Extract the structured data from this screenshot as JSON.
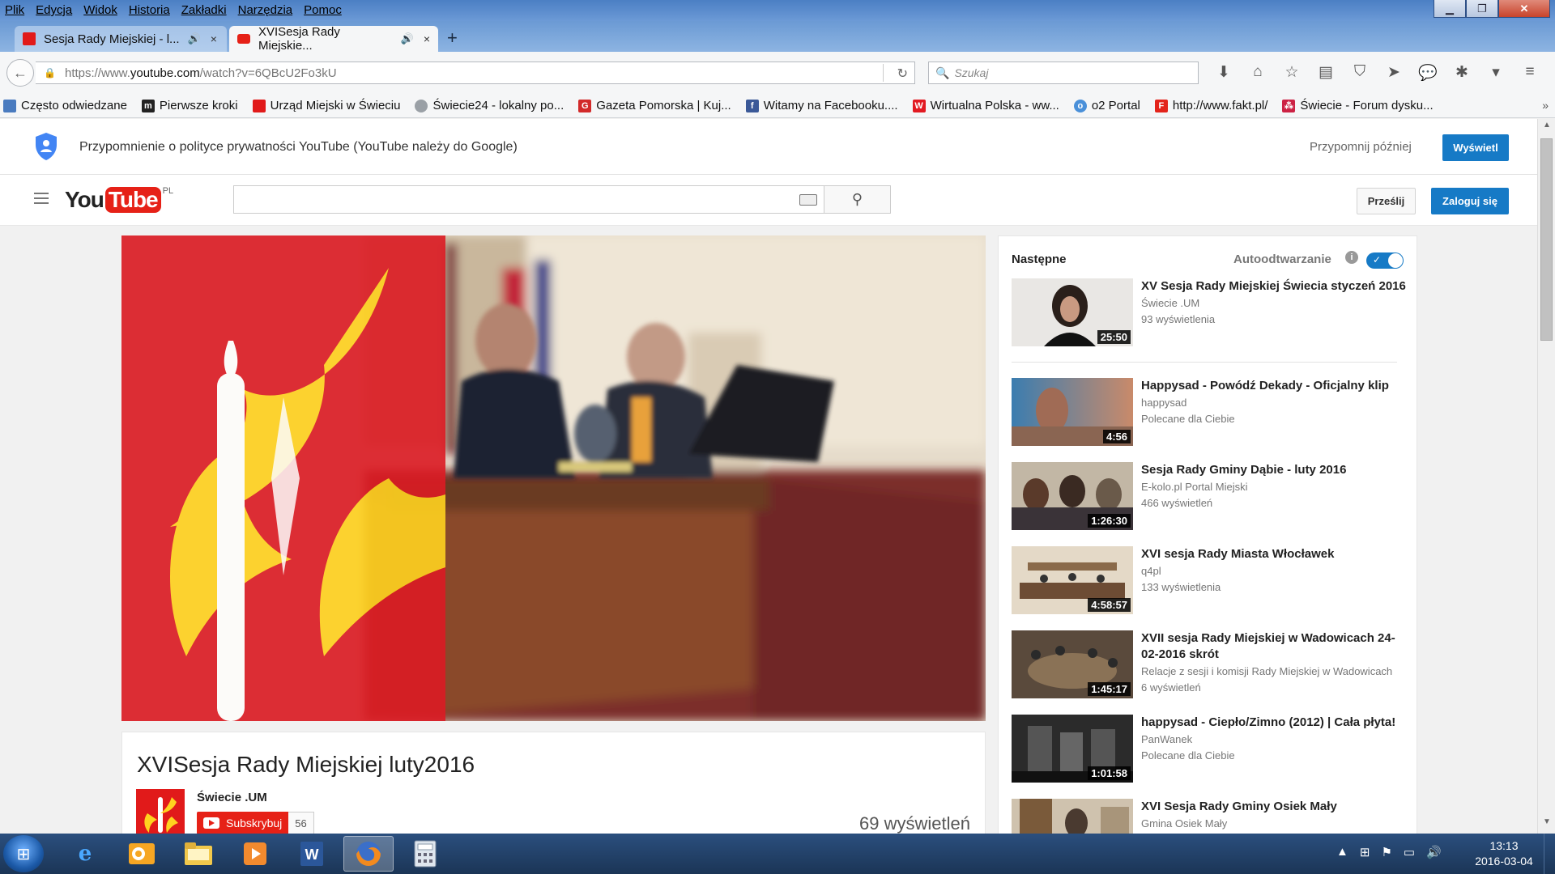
{
  "menubar": [
    "Plik",
    "Edycja",
    "Widok",
    "Historia",
    "Zakładki",
    "Narzędzia",
    "Pomoc"
  ],
  "tabs": [
    {
      "title": "Sesja Rady Miejskiej - l...",
      "audio": "🔊",
      "close": "×"
    },
    {
      "title": "XVISesja Rady Miejskie...",
      "audio": "🔊",
      "close": "×"
    }
  ],
  "new_tab": "+",
  "url": {
    "prefix": "https://www.",
    "host": "youtube.com",
    "path": "/watch?v=6QBcU2Fo3kU"
  },
  "search_placeholder": "Szukaj",
  "bookmarks": [
    {
      "label": "Często odwiedzane",
      "icon": "folder-icon",
      "color": "#4a7bbf"
    },
    {
      "label": "Pierwsze kroki",
      "icon": "mozilla-icon",
      "color": "#222222"
    },
    {
      "label": "Urząd Miejski w Świeciu",
      "icon": "swiecie-crest-icon",
      "color": "#e11a1a"
    },
    {
      "label": "Świecie24 - lokalny po...",
      "icon": "globe-icon",
      "color": "#9aa0a6"
    },
    {
      "label": "Gazeta Pomorska | Kuj...",
      "icon": "gp-icon",
      "color": "#d22a2a"
    },
    {
      "label": "Witamy na Facebooku....",
      "icon": "facebook-icon",
      "color": "#3b5998"
    },
    {
      "label": "Wirtualna Polska - ww...",
      "icon": "wp-icon",
      "color": "#e21a22"
    },
    {
      "label": "o2 Portal",
      "icon": "o2-icon",
      "color": "#4a90d9"
    },
    {
      "label": "http://www.fakt.pl/",
      "icon": "fakt-icon",
      "color": "#e3241b"
    },
    {
      "label": "Świecie - Forum dysku...",
      "icon": "forum-icon",
      "color": "#cc2244"
    }
  ],
  "privacy": {
    "message": "Przypomnienie o polityce prywatności YouTube (YouTube należy do Google)",
    "later": "Przypomnij później",
    "show": "Wyświetl"
  },
  "yt_header": {
    "logo_you": "You",
    "logo_tube": "Tube",
    "country": "PL",
    "upload": "Prześlij",
    "signin": "Zaloguj się"
  },
  "video": {
    "title": "XVISesja Rady Miejskiej luty2016",
    "channel": "Świecie .UM",
    "subscribe": "Subskrybuj",
    "subscribers": "56",
    "views": "69 wyświetleń"
  },
  "sidebar": {
    "next_label": "Następne",
    "autoplay_label": "Autoodtwarzanie",
    "info": "i",
    "autoplay_on": true,
    "items": [
      {
        "title": "XV Sesja Rady Miejskiej Świecia styczeń 2016",
        "channel": "Świecie .UM",
        "meta": "93 wyświetlenia",
        "duration": "25:50"
      },
      {
        "title": "Happysad - Powódź Dekady - Oficjalny klip",
        "channel": "happysad",
        "meta": "Polecane dla Ciebie",
        "duration": "4:56"
      },
      {
        "title": "Sesja Rady Gminy Dąbie - luty 2016",
        "channel": "E-kolo.pl Portal Miejski",
        "meta": "466 wyświetleń",
        "duration": "1:26:30"
      },
      {
        "title": "XVI sesja Rady Miasta Włocławek",
        "channel": "q4pl",
        "meta": "133 wyświetlenia",
        "duration": "4:58:57"
      },
      {
        "title": "XVII sesja Rady Miejskiej w Wadowicach 24-02-2016 skrót",
        "channel": "Relacje z sesji i komisji Rady Miejskiej w Wadowicach",
        "meta": "6 wyświetleń",
        "duration": "1:45:17"
      },
      {
        "title": "happysad - Ciepło/Zimno (2012) | Cała płyta!",
        "channel": "PanWanek",
        "meta": "Polecane dla Ciebie",
        "duration": "1:01:58"
      },
      {
        "title": "XVI Sesja Rady Gminy Osiek Mały",
        "channel": "Gmina Osiek Mały",
        "meta": "",
        "duration": ""
      }
    ]
  },
  "taskbar": {
    "apps": [
      "internet-explorer-icon",
      "outlook-icon",
      "explorer-icon",
      "media-player-icon",
      "word-icon",
      "firefox-icon",
      "calculator-icon"
    ],
    "active": "firefox-icon",
    "time": "13:13",
    "date": "2016-03-04"
  },
  "colors": {
    "yt_red": "#e62117",
    "yt_blue": "#167ac6",
    "swiecie_red": "#e11a1a"
  }
}
